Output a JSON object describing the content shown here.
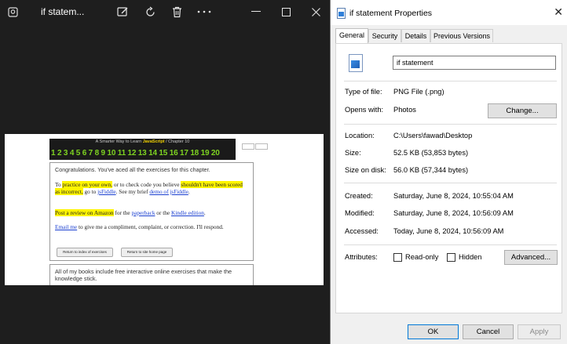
{
  "viewer": {
    "file_title": "if statem...",
    "tools": [
      "edit-image-icon",
      "rotate-icon",
      "delete-icon",
      "more-icon"
    ],
    "window_controls": [
      "minimize-icon",
      "maximize-icon",
      "close-icon"
    ],
    "photo": {
      "header_prefix": "A Smarter Way to Learn",
      "header_brand": "JavaScript",
      "header_suffix": "/ Chapter 10",
      "numbers": "1 2 3 4 5 6 7 8 9 10 11 12 13 14 15 16 17 18 19 20",
      "congrats": "Congratulations. You've aced all the exercises for this chapter.",
      "p1_a": "To ",
      "p1_hl1": "practice on your own,",
      "p1_b": " or to check code you believe ",
      "p1_hl2": "shouldn't have been scored as incorrect,",
      "p1_c": " go to ",
      "p1_link1": "jsFiddle",
      "p1_d": ". See my brief ",
      "p1_link2": "demo of jsFiddle",
      "p1_e": ".",
      "p2_hl": "Post a review on Amazon",
      "p2_a": " for the ",
      "p2_link1": "paperback",
      "p2_b": " or the ",
      "p2_link2": "Kindle edition",
      "p2_c": ".",
      "p3_link": "Email me",
      "p3_a": " to give me a compliment, complaint, or correction. I'll respond.",
      "btn1": "Return to index of exercises",
      "btn2": "Return to site home page",
      "books": "All of my books include free interactive online exercises that make the knowledge stick."
    }
  },
  "dialog": {
    "title": "if statement Properties",
    "tabs": [
      "General",
      "Security",
      "Details",
      "Previous Versions"
    ],
    "file_name": "if statement",
    "type_label": "Type of file:",
    "type_value": "PNG File (.png)",
    "opens_label": "Opens with:",
    "opens_value": "Photos",
    "change_button": "Change...",
    "location_label": "Location:",
    "location_value": "C:\\Users\\fawad\\Desktop",
    "size_label": "Size:",
    "size_value": "52.5 KB (53,853 bytes)",
    "size_disk_label": "Size on disk:",
    "size_disk_value": "56.0 KB (57,344 bytes)",
    "created_label": "Created:",
    "created_value": "Saturday, June 8, 2024, 10:55:04 AM",
    "modified_label": "Modified:",
    "modified_value": "Saturday, June 8, 2024, 10:56:09 AM",
    "accessed_label": "Accessed:",
    "accessed_value": "Today, June 8, 2024, 10:56:09 AM",
    "attributes_label": "Attributes:",
    "readonly_label": "Read-only",
    "hidden_label": "Hidden",
    "readonly_checked": false,
    "hidden_checked": false,
    "advanced_button": "Advanced...",
    "ok_button": "OK",
    "cancel_button": "Cancel",
    "apply_button": "Apply"
  }
}
